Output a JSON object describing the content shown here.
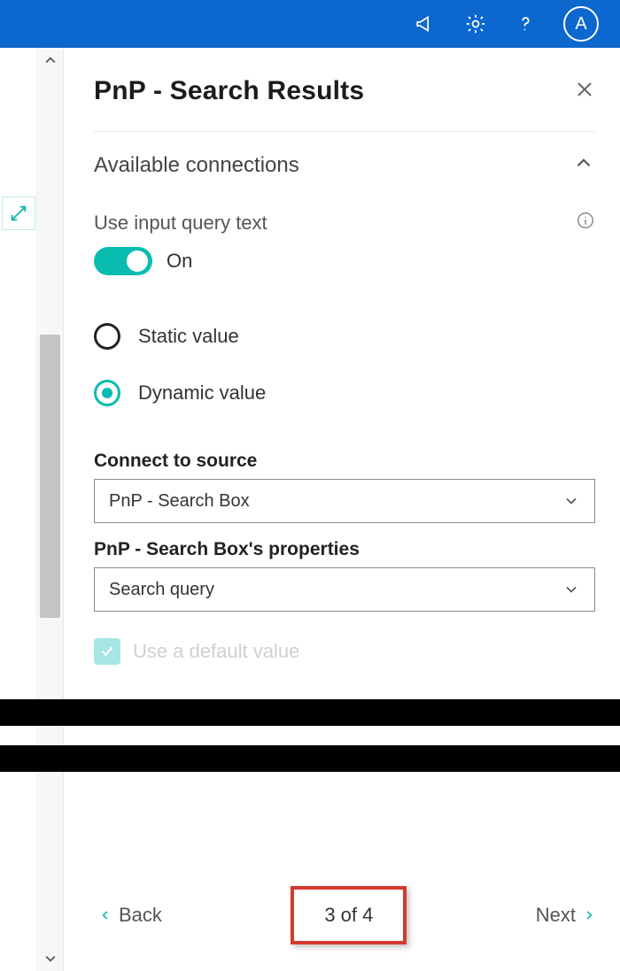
{
  "appbar": {
    "avatar_letter": "A"
  },
  "panel": {
    "title": "PnP - Search Results",
    "section_title": "Available connections",
    "use_input_label": "Use input query text",
    "toggle_state_label": "On",
    "radio_static": "Static value",
    "radio_dynamic": "Dynamic value",
    "connect_label": "Connect to source",
    "connect_value": "PnP - Search Box",
    "props_label": "PnP - Search Box's properties",
    "props_value": "Search query",
    "default_checkbox_label": "Use a default value"
  },
  "pager": {
    "back_label": "Back",
    "page_text": "3 of 4",
    "next_label": "Next"
  }
}
